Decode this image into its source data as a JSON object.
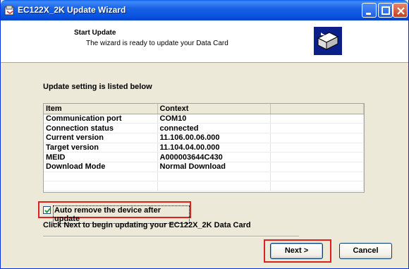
{
  "window": {
    "title": "EC122X_2K Update Wizard"
  },
  "header": {
    "title": "Start Update",
    "subtitle": "The wizard is ready to update your Data Card"
  },
  "settings": {
    "heading": "Update setting is listed below",
    "columns": [
      "Item",
      "Context"
    ],
    "rows": [
      [
        "Communication port",
        "COM10"
      ],
      [
        "Connection status",
        "connected"
      ],
      [
        "Current version",
        "11.106.00.06.000"
      ],
      [
        "Target version",
        "11.104.04.00.000"
      ],
      [
        "MEID",
        "A000003644C430"
      ],
      [
        "Download Mode",
        "Normal Download"
      ]
    ]
  },
  "options": {
    "auto_remove_label": "Auto remove the device after update",
    "auto_remove_checked": true
  },
  "hint": "Click Next to begin updating your EC122X_2K Data Card",
  "buttons": {
    "next": "Next >",
    "cancel": "Cancel"
  },
  "icons": {
    "app": "wizard-app-icon",
    "header": "update-card-icon"
  }
}
